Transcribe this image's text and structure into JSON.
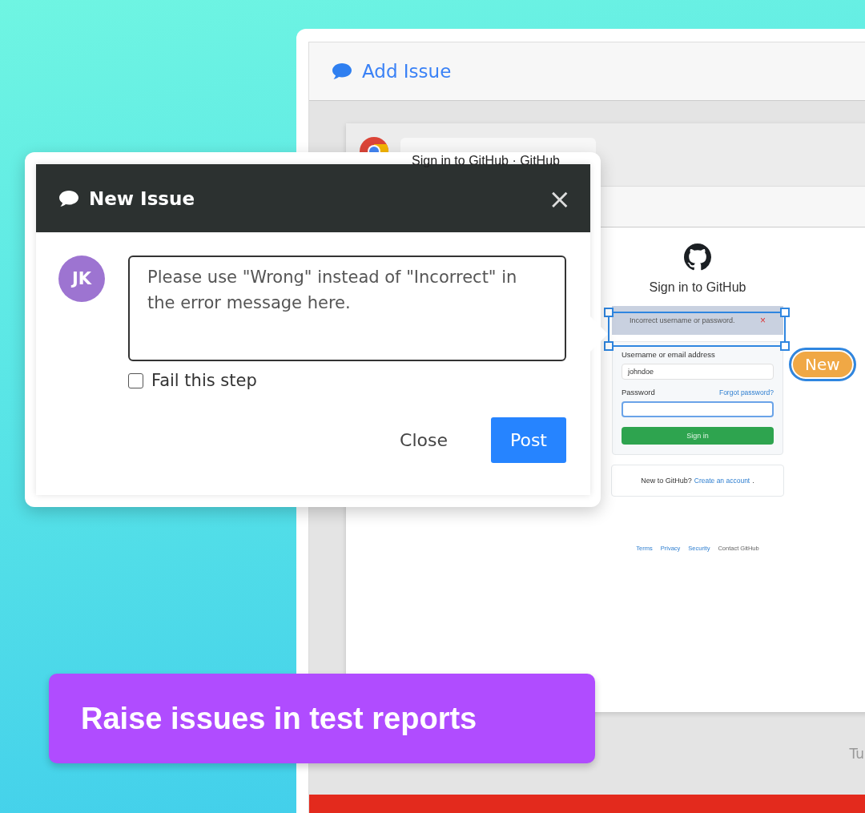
{
  "report_window": {
    "title": "Add Issue",
    "footer_text": "Tu"
  },
  "browser": {
    "tab_title": "Sign in to GitHub · GitHub",
    "page": {
      "heading": "Sign in to GitHub",
      "error": "Incorrect username or password.",
      "error_dismiss": "×",
      "username_label": "Username or email address",
      "username_value": "johndoe",
      "password_label": "Password",
      "forgot_link": "Forgot password?",
      "submit": "Sign in",
      "signup_text": "New to GitHub?",
      "signup_link": "Create an account",
      "signup_suffix": ".",
      "footer_links": [
        {
          "label": "Terms",
          "kind": "link"
        },
        {
          "label": "Privacy",
          "kind": "link"
        },
        {
          "label": "Security",
          "kind": "link"
        },
        {
          "label": "Contact GitHub",
          "kind": "text"
        }
      ]
    }
  },
  "annotation": {
    "badge": "New"
  },
  "dialog": {
    "title": "New Issue",
    "close": "×",
    "avatar": "JK",
    "comment": "Please use \"Wrong\" instead of \"Incorrect\" in the error message here.",
    "fail_step": {
      "label": "Fail this step",
      "checked": false
    },
    "buttons": [
      {
        "label": "Close",
        "kind": "secondary"
      },
      {
        "label": "Post",
        "kind": "primary"
      }
    ]
  },
  "tagline": "Raise issues in test reports"
}
